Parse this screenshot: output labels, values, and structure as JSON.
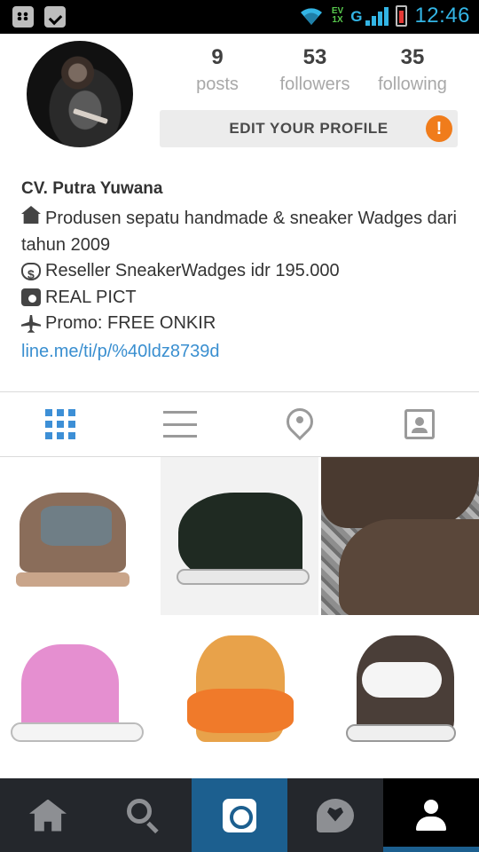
{
  "status_bar": {
    "time": "12:46",
    "network_top": "EV",
    "network_bottom": "1X",
    "signal_type": "G"
  },
  "profile": {
    "stats": [
      {
        "value": "9",
        "label": "posts"
      },
      {
        "value": "53",
        "label": "followers"
      },
      {
        "value": "35",
        "label": "following"
      }
    ],
    "edit_button_label": "EDIT YOUR PROFILE",
    "warning_badge": "!",
    "name": "CV. Putra Yuwana",
    "bio_lines": [
      "Produsen sepatu handmade & sneaker Wadges dari tahun 2009",
      "Reseller SneakerWadges idr 195.000",
      "REAL PICT",
      "Promo: FREE ONKIR"
    ],
    "link": "line.me/ti/p/%40ldz8739d"
  },
  "tabs": [
    "grid-icon",
    "list-icon",
    "location-pin-icon",
    "tagged-photos-icon"
  ],
  "bottom_nav": [
    "home-icon",
    "search-icon",
    "camera-icon",
    "activity-heart-icon",
    "profile-icon"
  ],
  "colors": {
    "accent_blue": "#3d8fd6",
    "link_blue": "#3a8fd0",
    "warning_orange": "#f07c1b",
    "nav_dark": "#24272c",
    "nav_active_camera": "#1c5f8f"
  }
}
